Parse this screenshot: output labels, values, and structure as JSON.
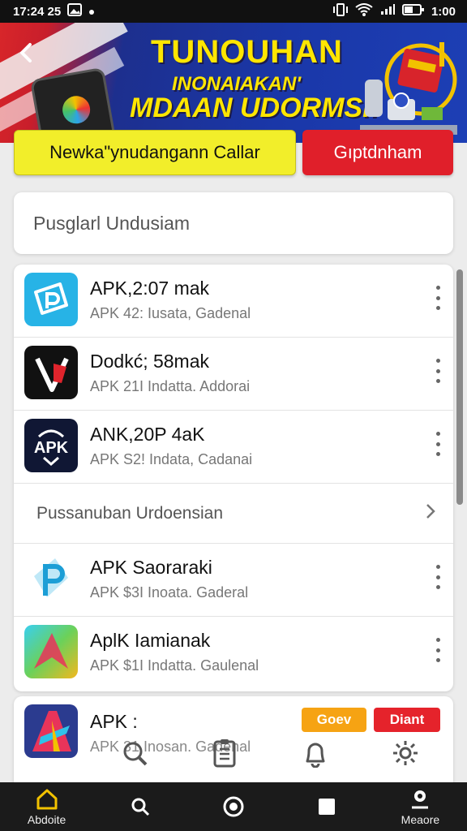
{
  "status_bar": {
    "time": "17:24 25",
    "right_time": "1:00"
  },
  "banner": {
    "line1": "TUNOUHAN",
    "line2": "INONAIAKAN'",
    "line3": "MDAAN UDORMSI!"
  },
  "actions": {
    "primary_label": "Newka\"ynudangann Callar",
    "secondary_label": "Gıptdnham"
  },
  "search": {
    "placeholder": "Pusglarl Undusiam"
  },
  "apps": [
    {
      "title": "APK,2:07 mak",
      "subtitle": "APK 42: Iusata, Gadenal",
      "icon": "p-folder-icon"
    },
    {
      "title": "Dodkć; 58mak",
      "subtitle": "APK 21I Indatta. Addorai",
      "icon": "v-tag-icon"
    },
    {
      "title": "ANK,20P 4aK",
      "subtitle": "APK S2! Indata, Cadanai",
      "icon": "apk-logo-icon"
    }
  ],
  "section": {
    "label": "Pussanuban Urdoensian"
  },
  "apps2": [
    {
      "title": "APK Saoraraki",
      "subtitle": "APK $3I Inoata. Gaderal",
      "icon": "p-logo-icon"
    },
    {
      "title": "AplK Iamianak",
      "subtitle": "APK $1I Indatta. Gaulenal",
      "icon": "gradient-arrow-icon"
    }
  ],
  "partial_app": {
    "title": "APK :",
    "subtitle": "APK 31 Inosan. Gadenal",
    "badge_left": "Goev",
    "badge_right": "Diant"
  },
  "bottom_nav": [
    {
      "label": "Abdoite",
      "icon": "home-icon"
    },
    {
      "label": "",
      "icon": "search-icon"
    },
    {
      "label": "",
      "icon": "record-icon"
    },
    {
      "label": "",
      "icon": "square-icon"
    },
    {
      "label": "Meaore",
      "icon": "profile-icon"
    }
  ],
  "colors": {
    "accent_yellow": "#f2ee2a",
    "accent_red": "#e01f2a",
    "banner_blue": "#1a37a8",
    "text_dark": "#111111"
  }
}
